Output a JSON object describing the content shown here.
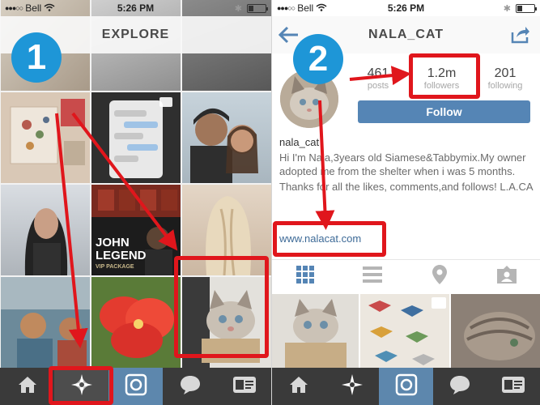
{
  "left_screen": {
    "status": {
      "carrier": "Bell",
      "time": "5:26 PM",
      "signal_dots": "●●●○○",
      "battery_level": 0.3
    },
    "nav_title": "EXPLORE",
    "tiles": [
      {
        "caption": ""
      },
      {
        "caption": ""
      },
      {
        "caption": ""
      },
      {
        "caption": ""
      },
      {
        "caption": ""
      },
      {
        "caption": ""
      },
      {
        "caption": ""
      },
      {
        "caption_line1": "JOHN",
        "caption_line2": "LEGEND",
        "caption_line3": "VIP PACKAGE"
      },
      {
        "caption": ""
      },
      {
        "caption": ""
      },
      {
        "caption": ""
      },
      {
        "caption": ""
      }
    ],
    "tabbar": [
      "home-icon",
      "explore-icon",
      "camera-icon",
      "activity-icon",
      "profile-icon"
    ],
    "active_tab": "explore-icon"
  },
  "right_screen": {
    "status": {
      "carrier": "Bell",
      "time": "5:26 PM",
      "signal_dots": "●●●○○",
      "battery_level": 0.3
    },
    "nav_title": "NALA_CAT",
    "stats": {
      "posts_num": "461",
      "posts_label": "posts",
      "followers_num": "1.2m",
      "followers_label": "followers",
      "following_num": "201",
      "following_label": "following"
    },
    "follow_label": "Follow",
    "username": "nala_cat",
    "bio_line1": "Hi I'm Nala,3years old Siamese&Tabbymix.My owner adopted me from the shelter when i was 5 months.",
    "bio_line2": "Thanks for all the likes, comments,and follows! L.A.CA",
    "website": "www.nalacat.com",
    "view_tabs": [
      "grid-icon",
      "list-icon",
      "location-pin-icon",
      "tagged-icon"
    ],
    "tabbar": [
      "home-icon",
      "explore-icon",
      "camera-icon",
      "activity-icon",
      "profile-icon"
    ]
  },
  "annotations": {
    "step1": "1",
    "step2": "2",
    "colors": {
      "highlight": "#e0161c",
      "badge": "#1e96d7"
    }
  }
}
